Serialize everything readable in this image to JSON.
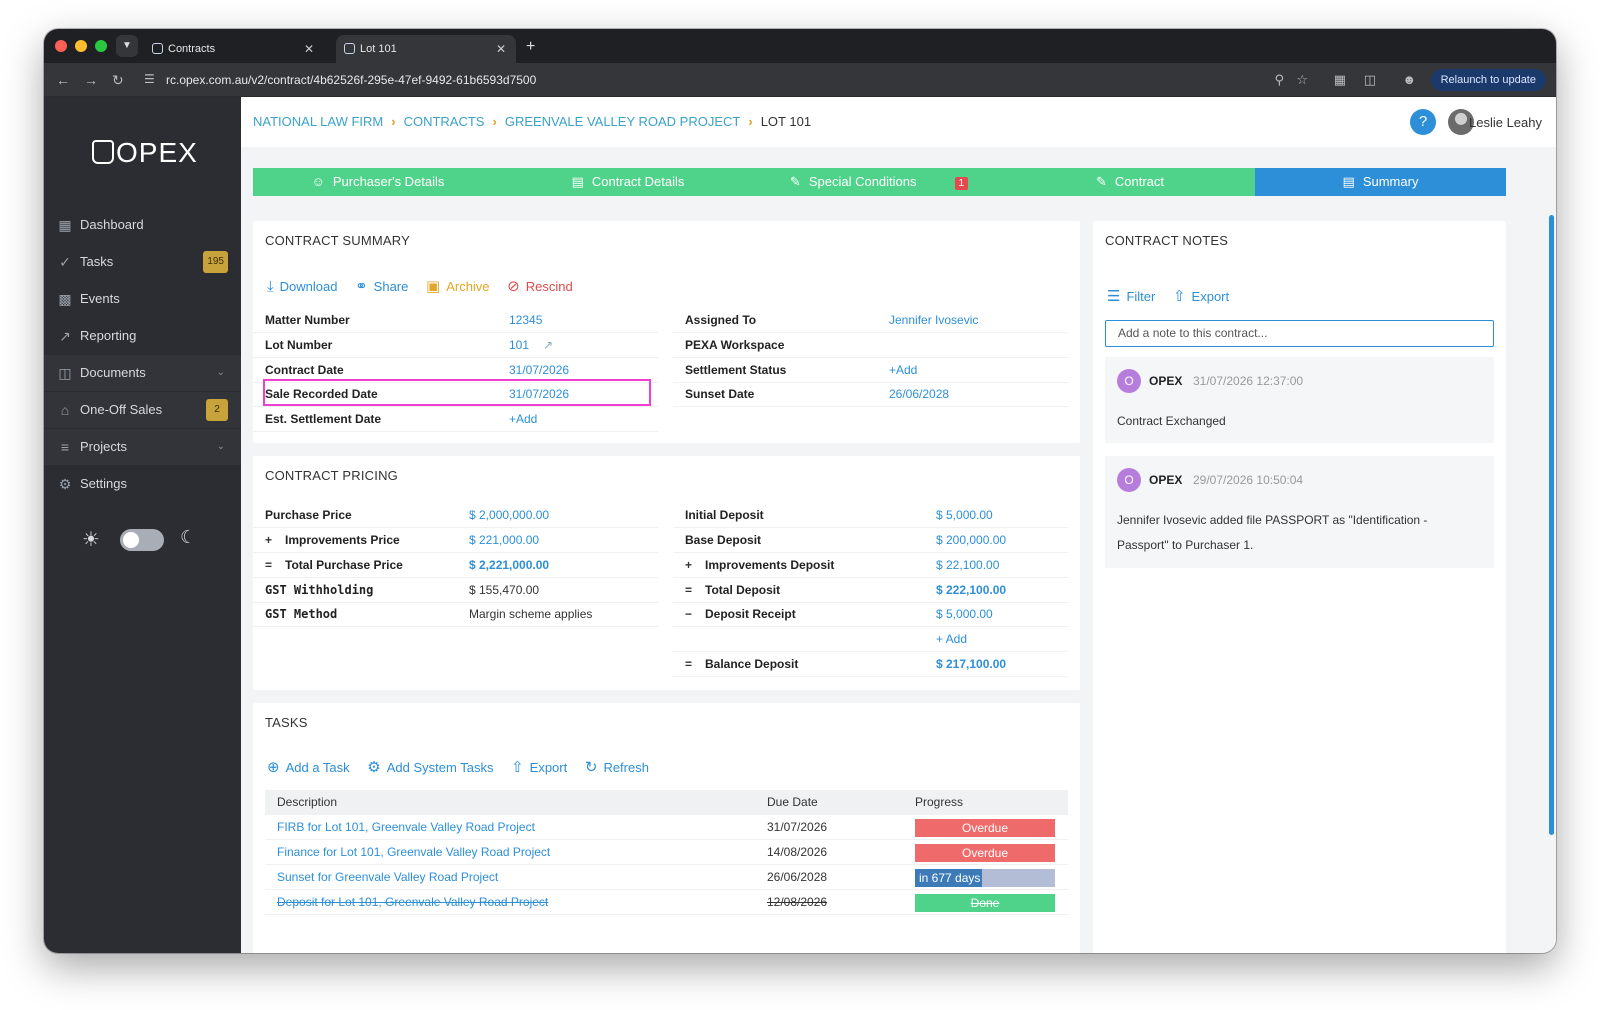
{
  "browser": {
    "tabs": [
      {
        "label": "Contracts"
      },
      {
        "label": "Lot 101"
      }
    ],
    "url": "rc.opex.com.au/v2/contract/4b62526f-295e-47ef-9492-61b6593d7500",
    "relaunch_label": "Relaunch to update"
  },
  "sidebar": {
    "logo": "OPEX",
    "items": [
      {
        "label": "Dashboard",
        "icon": "grid-icon"
      },
      {
        "label": "Tasks",
        "icon": "check-circle-icon",
        "badge": "195"
      },
      {
        "label": "Events",
        "icon": "calendar-icon"
      },
      {
        "label": "Reporting",
        "icon": "chart-icon"
      },
      {
        "label": "Documents",
        "icon": "document-icon"
      },
      {
        "label": "One-Off Sales",
        "icon": "home-icon",
        "badge": "2"
      },
      {
        "label": "Projects",
        "icon": "layers-icon"
      },
      {
        "label": "Settings",
        "icon": "gear-icon"
      }
    ]
  },
  "header": {
    "breadcrumbs": [
      "NATIONAL LAW FIRM",
      "CONTRACTS",
      "GREENVALE VALLEY ROAD PROJECT",
      "LOT 101"
    ],
    "user_name": "Leslie Leahy"
  },
  "steps": [
    {
      "label": "Purchaser's Details"
    },
    {
      "label": "Contract Details"
    },
    {
      "label": "Special Conditions",
      "badge": "1"
    },
    {
      "label": "Contract"
    },
    {
      "label": "Summary",
      "active": true
    }
  ],
  "summary": {
    "title": "CONTRACT SUMMARY",
    "actions": {
      "download": "Download",
      "share": "Share",
      "archive": "Archive",
      "rescind": "Rescind"
    },
    "left": [
      {
        "key": "Matter Number",
        "value": "12345"
      },
      {
        "key": "Lot Number",
        "value": "101"
      },
      {
        "key": "Contract Date",
        "value": "31/07/2026"
      },
      {
        "key": "Sale Recorded Date",
        "value": "31/07/2026"
      },
      {
        "key": "Est. Settlement Date",
        "value": "+Add"
      }
    ],
    "right": [
      {
        "key": "Assigned To",
        "value": "Jennifer Ivosevic"
      },
      {
        "key": "PEXA Workspace",
        "value": ""
      },
      {
        "key": "Settlement Status",
        "value": "+Add"
      },
      {
        "key": "Sunset Date",
        "value": "26/06/2028"
      }
    ]
  },
  "pricing": {
    "title": "CONTRACT PRICING",
    "left": [
      {
        "op": "",
        "key": "Purchase Price",
        "value": "$ 2,000,000.00"
      },
      {
        "op": "+",
        "key": "Improvements Price",
        "value": "$ 221,000.00"
      },
      {
        "op": "=",
        "key": "Total Purchase Price",
        "value": "$ 2,221,000.00"
      },
      {
        "op": "",
        "key": "GST Withholding",
        "value": "$ 155,470.00"
      },
      {
        "op": "",
        "key": "GST Method",
        "value": "Margin scheme applies"
      }
    ],
    "right": [
      {
        "op": "",
        "key": "Initial Deposit",
        "value": "$ 5,000.00"
      },
      {
        "op": "",
        "key": "Base Deposit",
        "value": "$ 200,000.00"
      },
      {
        "op": "+",
        "key": "Improvements Deposit",
        "value": "$ 22,100.00"
      },
      {
        "op": "=",
        "key": "Total Deposit",
        "value": "$ 222,100.00"
      },
      {
        "op": "−",
        "key": "Deposit Receipt",
        "value": "$ 5,000.00"
      },
      {
        "op": "",
        "key": "",
        "value": "+ Add"
      },
      {
        "op": "=",
        "key": "Balance Deposit",
        "value": "$ 217,100.00"
      }
    ]
  },
  "tasks": {
    "title": "TASKS",
    "actions": {
      "add": "Add a Task",
      "add_system": "Add System Tasks",
      "export": "Export",
      "refresh": "Refresh"
    },
    "columns": {
      "description": "Description",
      "due": "Due Date",
      "progress": "Progress"
    },
    "rows": [
      {
        "description": "FIRB for Lot 101, Greenvale Valley Road Project",
        "due": "31/07/2026",
        "progress": "Overdue",
        "status": "overdue"
      },
      {
        "description": "Finance for Lot 101, Greenvale Valley Road Project",
        "due": "14/08/2026",
        "progress": "Overdue",
        "status": "overdue"
      },
      {
        "description": "Sunset for Greenvale Valley Road Project",
        "due": "26/06/2028",
        "progress": "in 677 days",
        "status": "track",
        "fill": 0.48
      },
      {
        "description": "Deposit for Lot 101, Greenvale Valley Road Project",
        "due": "12/08/2026",
        "progress": "Done",
        "status": "done"
      }
    ]
  },
  "notes": {
    "title": "CONTRACT NOTES",
    "actions": {
      "filter": "Filter",
      "export": "Export"
    },
    "placeholder": "Add a note to this contract...",
    "items": [
      {
        "avatar": "O",
        "author": "OPEX",
        "time": "31/07/2026 12:37:00",
        "body": "Contract Exchanged"
      },
      {
        "avatar": "O",
        "author": "OPEX",
        "time": "29/07/2026 10:50:04",
        "body": "Jennifer  Ivosevic added file PASSPORT as \"Identification - Passport\" to Purchaser 1."
      }
    ]
  },
  "colors": {
    "accent": "#2d8fd8",
    "step_green": "#4fd38a",
    "overdue": "#ef6b6b",
    "highlight": "#ee3fd0"
  }
}
